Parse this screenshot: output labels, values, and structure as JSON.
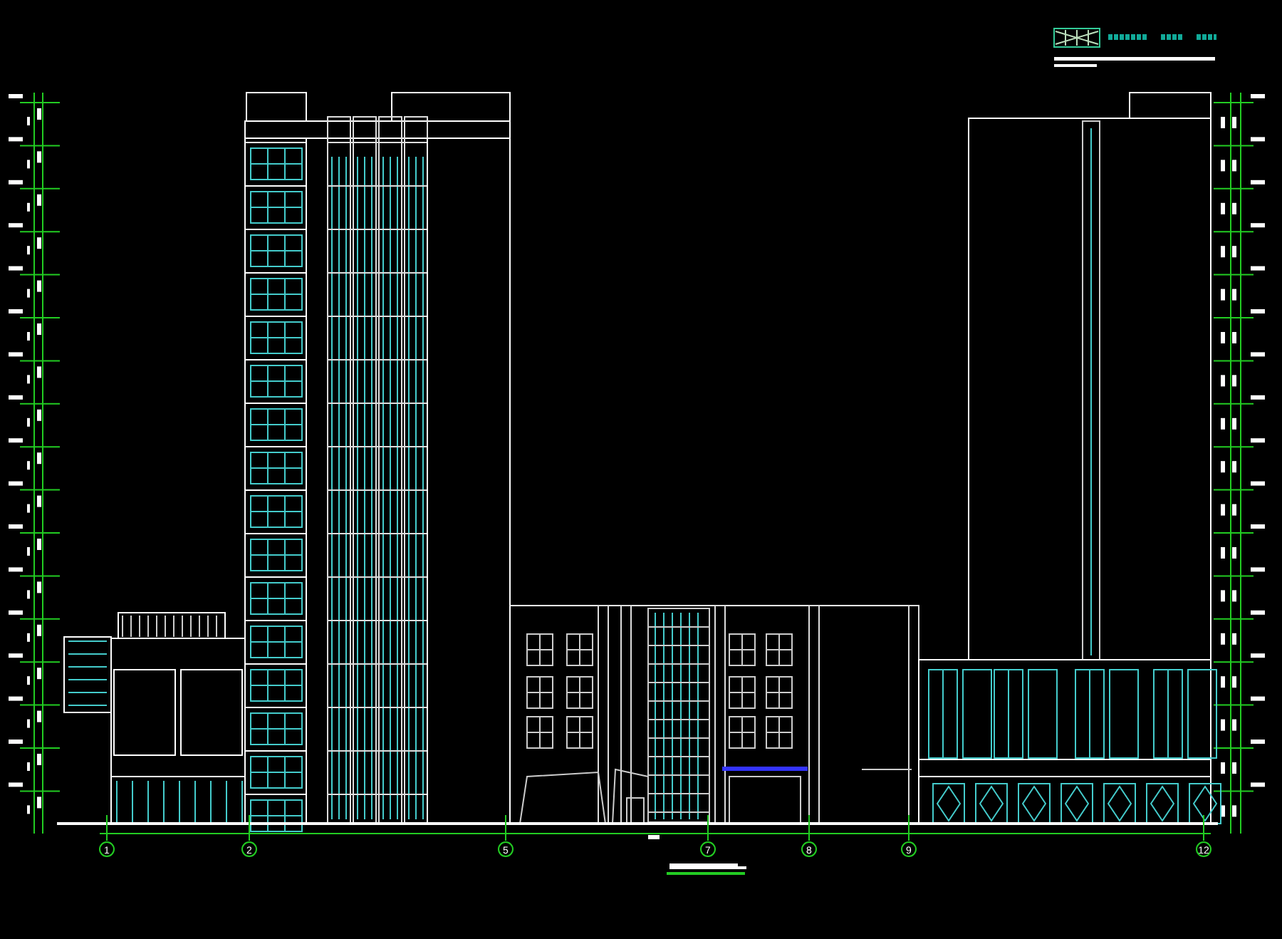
{
  "drawing": {
    "axis_bubbles": [
      {
        "label": "1"
      },
      {
        "label": "2"
      },
      {
        "label": "5"
      },
      {
        "label": "7"
      },
      {
        "label": "8"
      },
      {
        "label": "9"
      },
      {
        "label": "12"
      }
    ]
  }
}
